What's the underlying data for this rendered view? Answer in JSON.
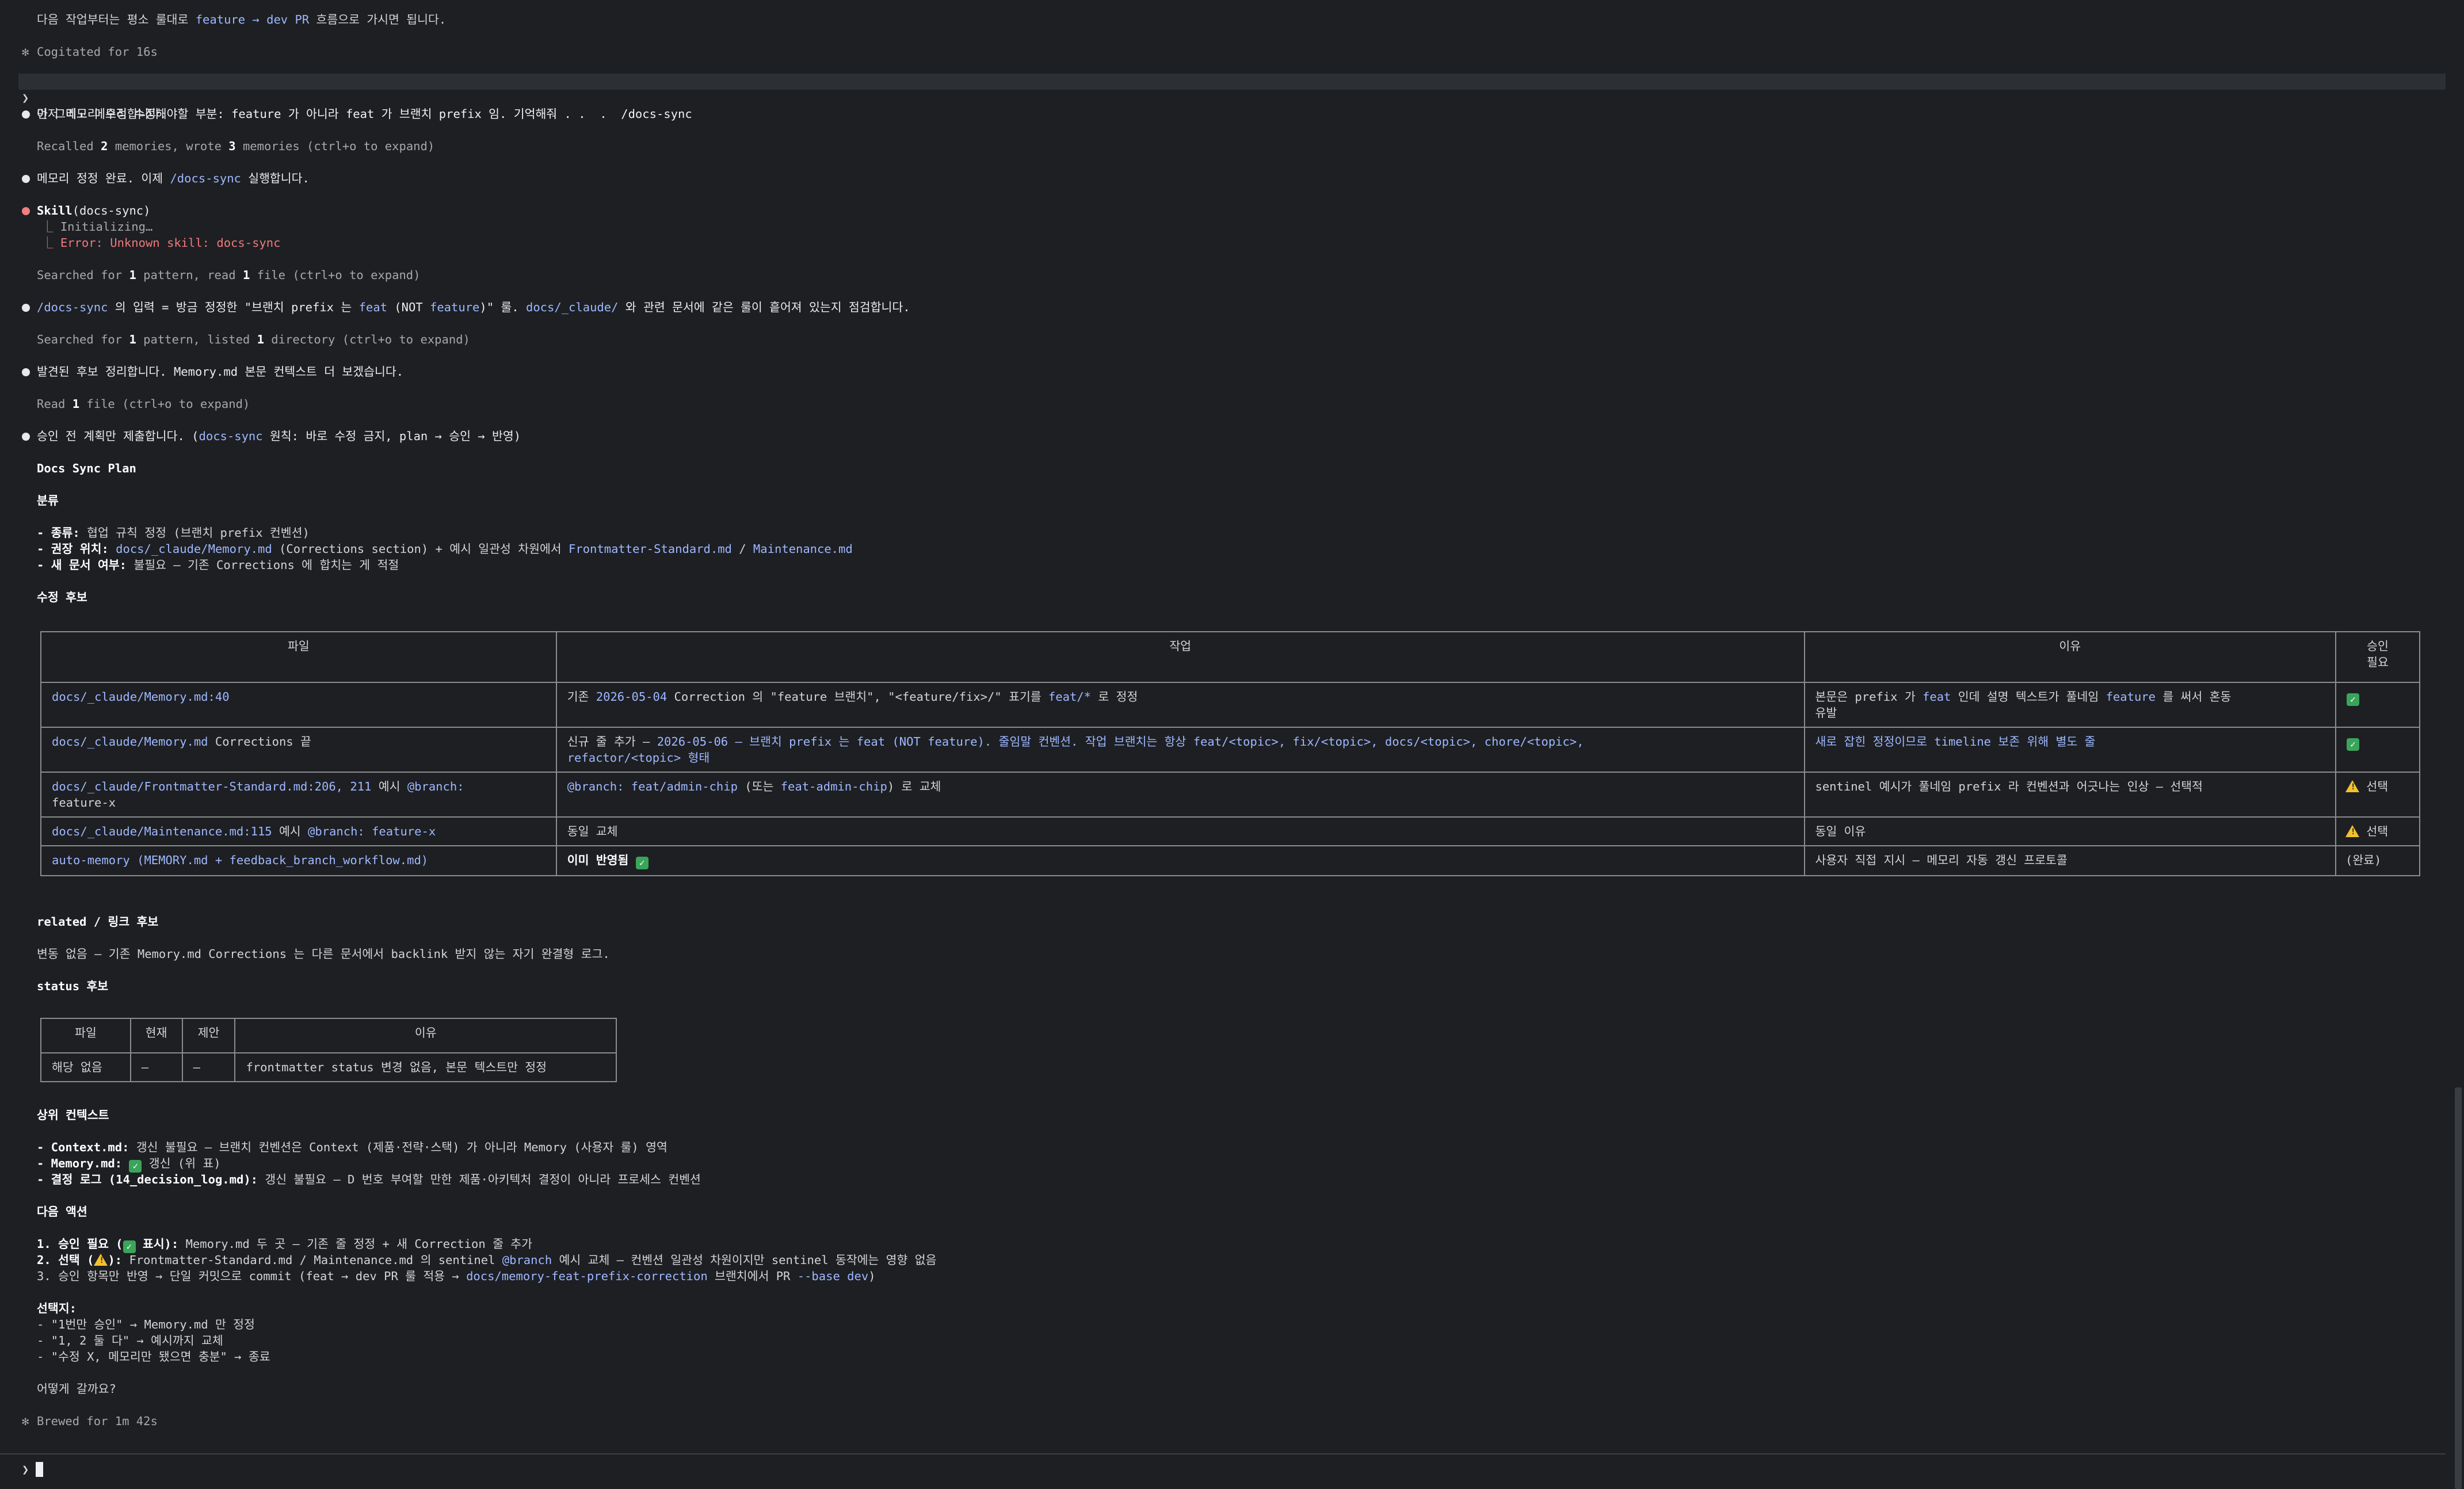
{
  "line_intro": "다음 작업부터는 평소 룰대로",
  "line_intro_flow": "feature → dev PR",
  "line_intro_end": "흐름으로 가시면 됩니다.",
  "cogitated": "Cogitated for 16s",
  "user_prompt": {
    "marker": "❯",
    "text_a": "아 그리고 메모리 수정해야할 부분: feature 가 아니라 feat 가 브랜치 prefix 임. 기억해줘 . .  .  ",
    "text_b": "/docs-sync"
  },
  "msg_memory_fix": "먼저 메모리 수정합니다.",
  "recalled": {
    "a": "Recalled ",
    "n1": "2",
    "b": " memories, wrote ",
    "n2": "3",
    "c": " memories (ctrl+o to expand)"
  },
  "msg_done": {
    "a": "메모리 정정 완료. 이제 ",
    "cmd": "/docs-sync",
    "b": " 실행합니다."
  },
  "skill": {
    "name": "Skill",
    "arg": "(docs-sync)",
    "init": "⎿ Initializing…",
    "error": "⎿ Error: Unknown skill: docs-sync"
  },
  "searched1": {
    "a": "Searched for ",
    "n1": "1",
    "b": " pattern, read ",
    "n2": "1",
    "c": " file (ctrl+o to expand)"
  },
  "msg_input": {
    "cmd": "/docs-sync",
    "a": " 의 입력 = 방금 정정한 \"브랜치 prefix 는 ",
    "feat": "feat",
    "b": " (NOT ",
    "feature": "feature",
    "c": ")\" 룰. ",
    "path": "docs/_claude/",
    "d": " 와 관련 문서에 같은 룰이 흩어져 있는지 점검합니다."
  },
  "searched2": {
    "a": "Searched for ",
    "n1": "1",
    "b": " pattern, listed ",
    "n2": "1",
    "c": " directory (ctrl+o to expand)"
  },
  "msg_found": "발견된 후보 정리합니다. Memory.md 본문 컨텍스트 더 보겠습니다.",
  "read_file": {
    "a": "Read ",
    "n": "1",
    "b": " file (ctrl+o to expand)"
  },
  "msg_plan": {
    "a": "승인 전 계획만 제출합니다. (",
    "cmd": "docs-sync",
    "b": " 원칙: 바로 수정 금지, plan → 승인 → 반영)"
  },
  "plan_title": "Docs Sync Plan",
  "sec_classify": "분류",
  "classify": {
    "kind_label": "- 종류:",
    "kind_value": " 협업 규칙 정정 (브랜치 prefix 컨벤션)",
    "loc_label": "- 권장 위치:",
    "loc_path1": "docs/_claude/Memory.md",
    "loc_mid": " (Corrections section) + 예시 일관성 차원에서 ",
    "loc_path2": "Frontmatter-Standard.md",
    "loc_sep": " / ",
    "loc_path3": "Maintenance.md",
    "new_label": "- 새 문서 여부:",
    "new_value": " 불필요 — 기존 Corrections 에 합치는 게 적절"
  },
  "sec_candidates": "수정 후보",
  "cand_table": {
    "headers": [
      "파일",
      "작업",
      "이유",
      "승인\n필요"
    ],
    "rows": [
      {
        "file": "docs/_claude/Memory.md:40",
        "task_a": "기존 ",
        "task_date": "2026-05-04",
        "task_b": " Correction 의 \"feature 브랜치\", \"<feature/fix>/\" 표기를 ",
        "task_hl": "feat/*",
        "task_c": " 로 정정",
        "why_a": "본문은 prefix 가 ",
        "why_hl1": "feat",
        "why_b": " 인데 설명 텍스트가 풀네임 ",
        "why_hl2": "feature",
        "why_c": " 를 써서 혼동\n 유발",
        "approve": "check"
      },
      {
        "file": "docs/_claude/Memory.md",
        "file_rest": " Corrections 끝",
        "task_a": "신규 줄 추가 — ",
        "task_hl": "2026-05-06 — 브랜치 prefix 는 feat (NOT feature). 줄임말 컨벤션. 작업 브랜치는 항상 feat/<topic>, fix/<topic>, docs/<topic>, chore/<topic>,\nrefactor/<topic> 형태",
        "why_hl": "새로 잡힌 정정이므로 timeline 보존 위해 별도 줄",
        "approve": "check"
      },
      {
        "file": "docs/_claude/Frontmatter-Standard.md:206, 211",
        "file_rest": " 예시 ",
        "file_hl": "@branch:",
        "file_tail": "\nfeature-x",
        "task_hl1": "@branch: feat/admin-chip",
        "task_a": " (또는 ",
        "task_hl2": "feat-admin-chip",
        "task_b": ") 로 교체",
        "why": "sentinel 예시가 풀네임 prefix 라 컨벤션과 어긋나는 인상 — 선택적",
        "approve": "warn",
        "approve_text": "선택"
      },
      {
        "file": "docs/_claude/Maintenance.md:115",
        "file_rest": " 예시 ",
        "file_hl": "@branch: feature-x",
        "task": "동일 교체",
        "why": "동일 이유",
        "approve": "warn",
        "approve_text": "선택"
      },
      {
        "file": "auto-memory (MEMORY.md + feedback_branch_workflow.md)",
        "task_b": "이미 반영됨",
        "task_icon": "check",
        "why": "사용자 직접 지시 — 메모리 자동 갱신 프로토콜",
        "approve_text": "(완료)"
      }
    ]
  },
  "sec_related": "related / 링크 후보",
  "related_text": "변동 없음 — 기존 Memory.md Corrections 는 다른 문서에서 backlink 받지 않는 자기 완결형 로그.",
  "sec_status": "status 후보",
  "status_table": {
    "headers": [
      "파일",
      "현재",
      "제안",
      "이유"
    ],
    "row": [
      "해당 없음",
      "—",
      "—",
      "frontmatter status 변경 없음, 본문 텍스트만 정정"
    ]
  },
  "sec_context": "상위 컨텍스트",
  "context": {
    "l1_label": "- Context.md:",
    "l1_value": " 갱신 불필요 — 브랜치 컨벤션은 Context (제품·전략·스택) 가 아니라 Memory (사용자 룰) 영역",
    "l2_label": "- Memory.md:",
    "l2_value": " 갱신 (위 표)",
    "l3_label": "- 결정 로그 (",
    "l3_path": "14_decision_log.md",
    "l3_label_end": "):",
    "l3_value": " 갱신 불필요 — D 번호 부여할 만한 제품·아키텍처 결정이 아니라 프로세스 컨벤션"
  },
  "sec_next": "다음 액션",
  "next": {
    "n1_label": "1. 승인 필요 (",
    "n1_label_end": " 표시):",
    "n1_value": " Memory.md 두 곳 — 기존 줄 정정 + 새 Correction 줄 추가",
    "n2_label": "2. 선택 (",
    "n2_label_end": "):",
    "n2_a": " Frontmatter-Standard.md / Maintenance.md 의 sentinel ",
    "n2_hl": "@branch",
    "n2_b": " 예시 교체 — 컨벤션 일관성 차원이지만 sentinel 동작에는 영향 없음",
    "n3_a": "3. 승인 항목만 반영 → 단일 커밋으로 commit (feat → dev PR 룰 적용 → ",
    "n3_hl1": "docs/memory-feat-prefix-correction",
    "n3_b": " 브랜치에서 PR ",
    "n3_hl2": "--base dev",
    "n3_c": ")"
  },
  "choices_title": "선택지:",
  "choices": [
    "- \"1번만 승인\" → Memory.md 만 정정",
    "- \"1, 2 둘 다\" → 예시까지 교체",
    "- \"수정 X, 메모리만 됐으면 충분\" → 종료"
  ],
  "question": "어떻게 갈까요?",
  "brewed": "Brewed for 1m 42s",
  "input": {
    "marker": "❯",
    "value": ""
  },
  "icons": {
    "star": "✻",
    "check": "check-icon",
    "warn": "warning-icon"
  },
  "colors": {
    "background": "#1d1f23",
    "highlight": "#9fb8ff",
    "error": "#f07a7a",
    "bullet": "#e8e8e8",
    "bullet_error": "#f08080"
  }
}
